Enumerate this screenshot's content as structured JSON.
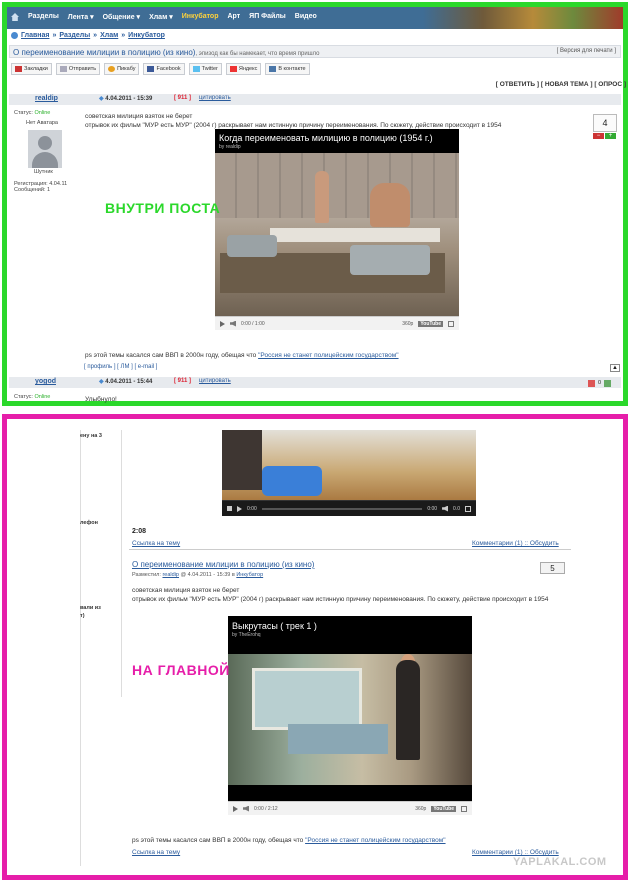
{
  "nav": {
    "items": [
      "Разделы",
      "Лента ▾",
      "Общение ▾",
      "Хлам ▾",
      "Инкубатор",
      "Арт",
      "ЯП Файлы",
      "Видео"
    ]
  },
  "breadcrumb": [
    "Главная",
    "Разделы",
    "Хлам",
    "Инкубатор"
  ],
  "topic": {
    "title": "О переименование милиции в полицию (из кино)",
    "subtitle": ", эпизод как бы намекает, что время пришло",
    "print": "[ Версия для печати ]"
  },
  "share": [
    "Закладки",
    "Отправить",
    "Пикабу",
    "Facebook",
    "Twitter",
    "Яндекс",
    "В контакте"
  ],
  "actions": "[ ОТВЕТИТЬ ] [ НОВАЯ ТЕМА ] [ ОПРОС ]",
  "post1": {
    "author": "realdip",
    "date": "4.04.2011 - 15:39",
    "num": "911",
    "quote": "цитировать",
    "status_label": "Статус:",
    "status": "Online",
    "no_avatar": "Нет Аватара",
    "rank": "Шутник",
    "reg": "Регистрация: 4.04.11",
    "msgs": "Сообщений: 1",
    "line1": "советская милиция взяток не берет",
    "line2": "отрывок их фильм \"МУР есть МУР\" (2004 г) раскрывает нам истинную причину переименования. По сюжету, действие происходит в 1954",
    "rating": "4",
    "video_title": "Когда переименовать милицию в полицию (1954 г.)",
    "video_by": "by realdip",
    "video_time": "0:00 / 1:00",
    "quality": "360p",
    "yt": "YouTube",
    "ps_prefix": "ps этой темы касался сам ВВП в 2000н году, обещая что ",
    "ps_link": "\"Россия не станет полицейским государством\"",
    "links": "[ профиль ] [ ЛМ ] [ e-mail ]",
    "up": "▲"
  },
  "post2": {
    "author": "yogod",
    "date": "4.04.2011 - 15:44",
    "num": "911",
    "quote": "цитировать",
    "status_label": "Статус:",
    "status": "Online",
    "text": "Улыбнуло!",
    "counter": "0"
  },
  "annotations": {
    "green": "ВНУТРИ ПОСТА",
    "pink": "НА ГЛАВНОЙ"
  },
  "main": {
    "left_labels": [
      "ену на 3",
      "лефон",
      "вали из",
      "т)"
    ],
    "prev_video_time": "0:00",
    "prev_video_time_right": "0:00",
    "prev_vol": "0.0",
    "time": "2:08",
    "link": "Ссылка на тему",
    "comments": "Комментарии (1) :: ",
    "discuss": "Обсудить",
    "post_title": "О переименование милиции в полицию (из кино)",
    "meta_label": "Разместил:",
    "meta_author": "realdip",
    "meta_date": "@ 4.04.2011 - 15:39 в ",
    "meta_section": "Инкубатор",
    "rating": "5",
    "line1": "советская милиция взяток не берет",
    "line2": "отрывок их фильм \"МУР есть МУР\" (2004 г) раскрывает нам истинную причину переименования. По сюжету, действие происходит в 1954",
    "video_title": "Выкрутасы ( трек 1 )",
    "video_by": "by TheErohq",
    "video_time": "0:00 / 2:12",
    "quality": "360p",
    "yt": "YouTube",
    "ps_prefix": "ps этой темы касался сам ВВП в 2000н году, обещая что ",
    "ps_link": "\"Россия не станет полицейским государством\"",
    "link2": "Ссылка на тему",
    "comments2": "Комментарии (1) :: ",
    "discuss2": "Обсудить"
  },
  "watermark": "YAPLAKAL.COM"
}
